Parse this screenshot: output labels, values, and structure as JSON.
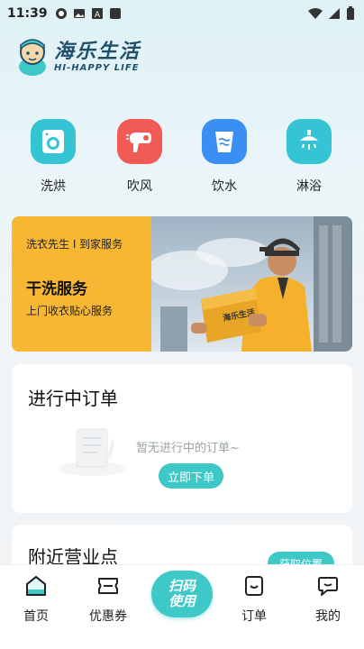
{
  "status_bar": {
    "time": "11:39"
  },
  "brand": {
    "name_cn": "海乐生活",
    "name_en": "HI-HAPPY LIFE"
  },
  "services": [
    {
      "label": "洗烘",
      "icon": "washing-machine-icon",
      "color": "#34c4d4"
    },
    {
      "label": "吹风",
      "icon": "hair-dryer-icon",
      "color": "#f25a55"
    },
    {
      "label": "饮水",
      "icon": "water-cup-icon",
      "color": "#3a8ff2"
    },
    {
      "label": "淋浴",
      "icon": "shower-icon",
      "color": "#34c4d4"
    }
  ],
  "banner": {
    "subtitle": "洗衣先生 I 到家服务",
    "title": "干洗服务",
    "desc": "上门收衣贴心服务",
    "box_text": "海乐生活",
    "color": "#f7b733"
  },
  "orders": {
    "title": "进行中订单",
    "empty_text": "暂无进行中的订单~",
    "button": "立即下单"
  },
  "nearby": {
    "title": "附近营业点",
    "button": "获取位置"
  },
  "tabbar": {
    "home": "首页",
    "coupons": "优惠券",
    "scan_line1": "扫码",
    "scan_line2": "使用",
    "orders": "订单",
    "mine": "我的"
  },
  "colors": {
    "accent": "#3ec8c8",
    "brand_dark": "#1f4f6b"
  }
}
